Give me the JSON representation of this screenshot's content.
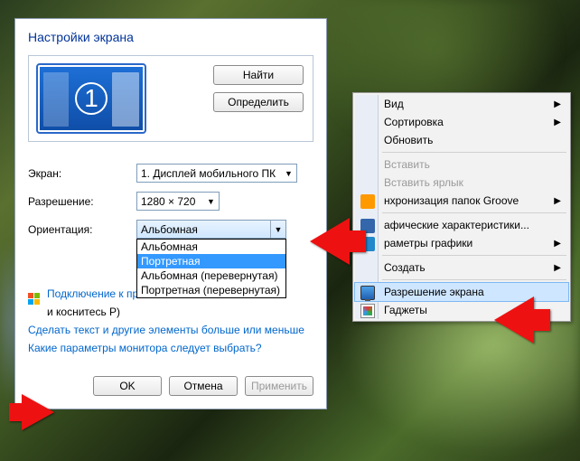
{
  "dialog": {
    "title": "Настройки экрана",
    "detect_btn": "Найти",
    "identify_btn": "Определить",
    "monitor_number": "1",
    "labels": {
      "display": "Экран:",
      "resolution": "Разрешение:",
      "orientation": "Ориентация:"
    },
    "display_value": "1. Дисплей мобильного ПК",
    "resolution_value": "1280 × 720",
    "orientation_value": "Альбомная",
    "orientation_options": [
      "Альбомная",
      "Портретная",
      "Альбомная (перевернутая)",
      "Портретная (перевернутая)"
    ],
    "orientation_selected_index": 1,
    "projector_link": "Подключение к проек",
    "projector_sub": "и коснитесь P)",
    "link_text_size": "Сделать текст и другие элементы больше или меньше",
    "link_which_params": "Какие параметры монитора следует выбрать?",
    "ok_btn": "OK",
    "cancel_btn": "Отмена",
    "apply_btn": "Применить"
  },
  "context_menu": {
    "view": "Вид",
    "sort": "Сортировка",
    "refresh": "Обновить",
    "paste": "Вставить",
    "paste_shortcut": "Вставить ярлык",
    "groove": "нхронизация папок Groove",
    "gfx_props": "афические характеристики...",
    "gfx_params": "раметры графики",
    "create": "Создать",
    "resolution": "Разрешение экрана",
    "gadgets": "Гаджеты"
  }
}
